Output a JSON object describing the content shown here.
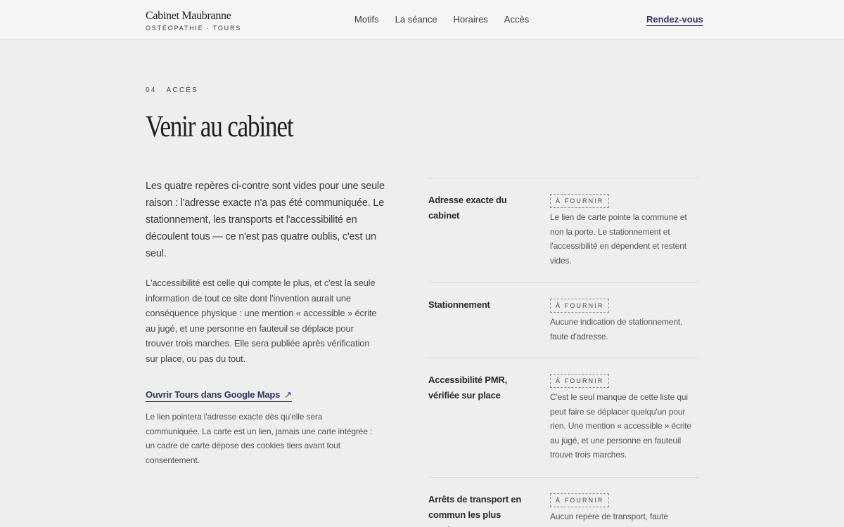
{
  "header": {
    "brand_name": "Cabinet Maubranne",
    "brand_sub": "OSTÉOPATHIE · TOURS",
    "nav": [
      "Motifs",
      "La séance",
      "Horaires",
      "Accès"
    ],
    "cta": "Rendez-vous"
  },
  "section": {
    "number": "04",
    "eyebrow": "ACCÈS",
    "title": "Venir au cabinet"
  },
  "intro": {
    "lead": "Les quatre repères ci-contre sont vides pour une seule raison : l'adresse exacte n'a pas été communiquée. Le stationnement, les transports et l'accessibilité en découlent tous — ce n'est pas quatre oublis, c'est un seul.",
    "body": "L'accessibilité est celle qui compte le plus, et c'est la seule information de tout ce site dont l'invention aurait une conséquence physique : une mention « accessible » écrite au jugé, et une personne en fauteuil se déplace pour trouver trois marches. Elle sera publiée après vérification sur place, ou pas du tout.",
    "maps_link": "Ouvrir Tours dans Google Maps",
    "maps_arrow": "↗",
    "note": "Le lien pointera l'adresse exacte dès qu'elle sera communiquée. La carte est un lien, jamais une carte intégrée : un cadre de carte dépose des cookies tiers avant tout consentement."
  },
  "items": [
    {
      "label": "Adresse exacte du cabinet",
      "badge": "À FOURNIR",
      "text": "Le lien de carte pointe la commune et non la porte. Le stationnement et l'accessibilité en dépendent et restent vides."
    },
    {
      "label": "Stationnement",
      "badge": "À FOURNIR",
      "text": "Aucune indication de stationnement, faute d'adresse."
    },
    {
      "label": "Accessibilité PMR, vérifiée sur place",
      "badge": "À FOURNIR",
      "text": "C'est le seul manque de cette liste qui peut faire se déplacer quelqu'un pour rien. Une mention « accessible » écrite au jugé, et une personne en fauteuil trouve trois marches."
    },
    {
      "label": "Arrêts de transport en commun les plus proches",
      "badge": "À FOURNIR",
      "text": "Aucun repère de transport, faute d'adresse."
    }
  ]
}
